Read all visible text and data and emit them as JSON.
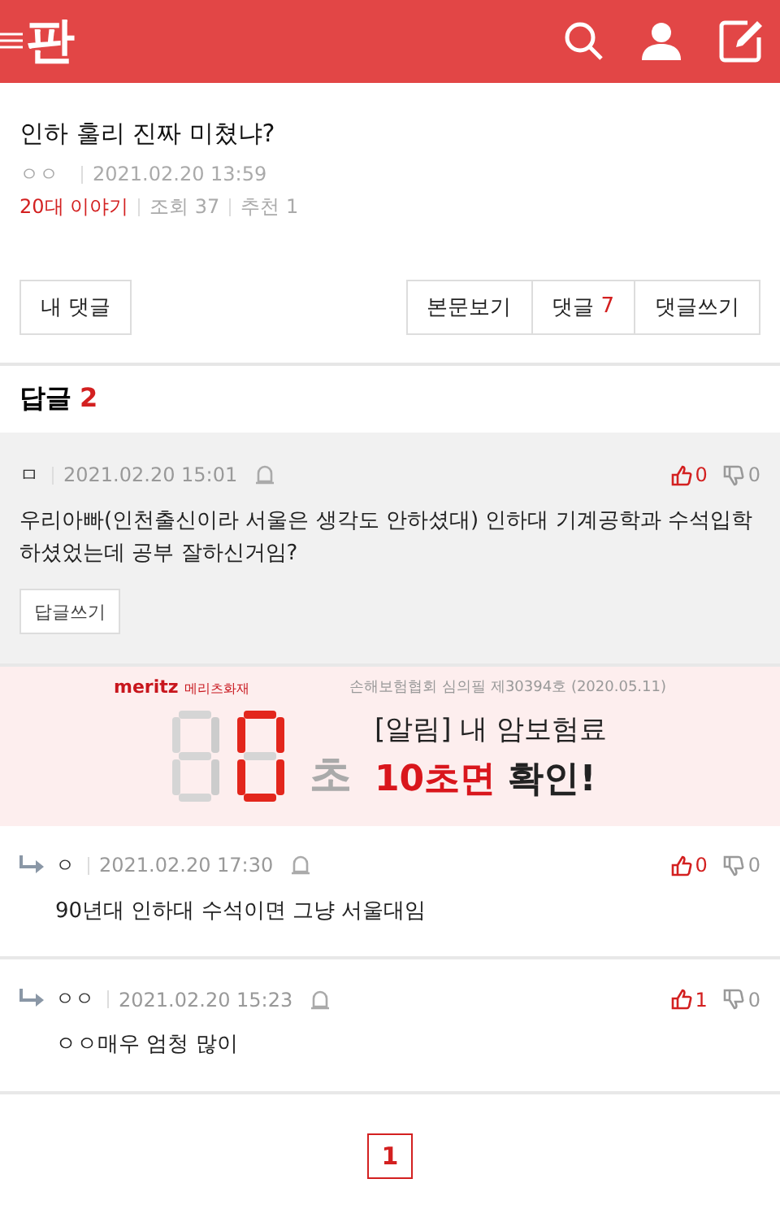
{
  "header": {
    "logo": "판"
  },
  "post": {
    "title": "인하 훌리 진짜 미쳤냐?",
    "author": "ㅇㅇ",
    "date": "2021.02.20 13:59",
    "category": "20대 이야기",
    "views": "조회 37",
    "recommends": "추천 1"
  },
  "actions": {
    "my_comments": "내 댓글",
    "view_post": "본문보기",
    "comments_label": "댓글",
    "comments_count": "7",
    "write_comment": "댓글쓰기"
  },
  "replies_heading": {
    "label": "답글",
    "count": "2"
  },
  "comments": [
    {
      "kind": "comment",
      "author": "ㅁ",
      "date": "2021.02.20 15:01",
      "likes": "0",
      "dislikes": "0",
      "text": "우리아빠(인천출신이라 서울은 생각도 안하셨대) 인하대 기계공학과 수석입학 하셨었는데 공부 잘하신거임?",
      "reply_button": "답글쓰기"
    },
    {
      "kind": "reply",
      "author": "ㅇ",
      "date": "2021.02.20 17:30",
      "likes": "0",
      "dislikes": "0",
      "text": "90년대 인하대 수석이면 그냥 서울대임"
    },
    {
      "kind": "reply",
      "author": "ㅇㅇ",
      "date": "2021.02.20 15:23",
      "likes": "1",
      "dislikes": "0",
      "text": "ㅇㅇ매우 엄청 많이"
    }
  ],
  "ad": {
    "brand": "meritz",
    "brand_sub": "메리츠화재",
    "notice": "손해보험협회 심의필 제30394호 (2020.05.11)",
    "unit": "초",
    "line1": "[알림] 내 암보험료",
    "line2": "**10초면** 확인!"
  },
  "pagination": [
    {
      "label": "1",
      "selected": true
    }
  ]
}
